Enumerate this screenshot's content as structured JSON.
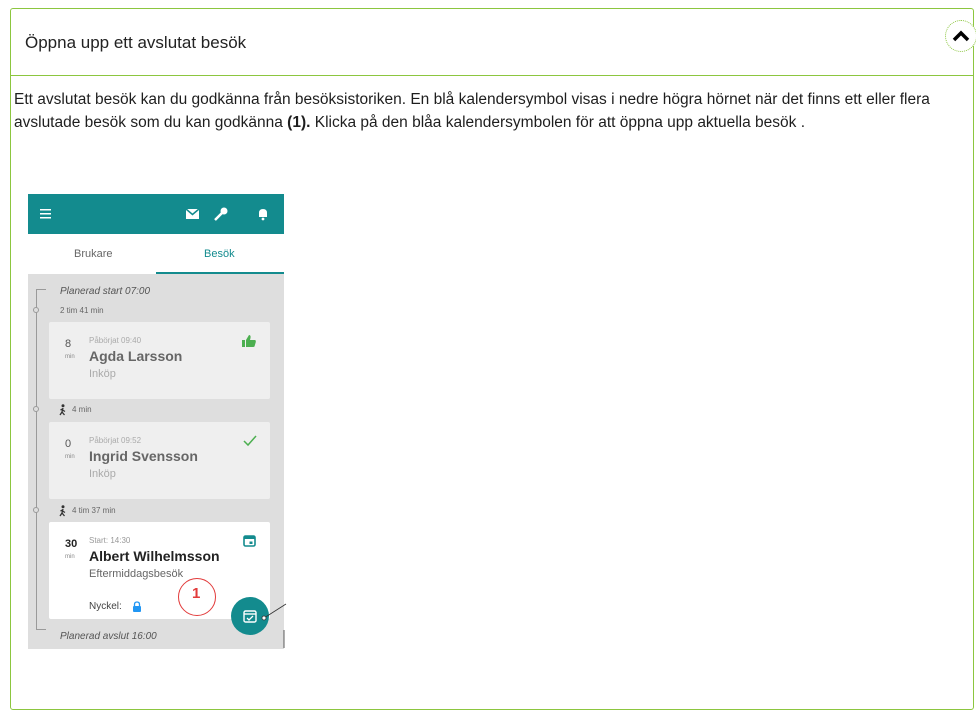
{
  "accordion": {
    "title": "Öppna upp ett avslutat besök",
    "toggle_icon": "chevron-up-icon"
  },
  "body": {
    "text_part1": "Ett avslutat besök kan du godkänna från besöksistoriken. En blå kalendersymbol visas i nedre högra hörnet när det finns ett eller flera avslutade besök som du kan godkänna ",
    "bold_ref": "(1).",
    "text_part2": " Klicka på den blåa kalendersymbolen för att öppna upp aktuella besök ."
  },
  "phone": {
    "colors": {
      "teal": "#138b8e",
      "green": "#4caf50",
      "marker": "#e23b3b"
    },
    "topbar_icons": [
      "menu-icon",
      "mail-icon",
      "key-icon",
      "bell-icon"
    ],
    "tabs": [
      {
        "label": "Brukare",
        "active": false
      },
      {
        "label": "Besök",
        "active": true
      }
    ],
    "planned_start": "Planerad start 07:00",
    "gap1": "2 tim 41 min",
    "visits": [
      {
        "minutes": "8",
        "unit": "min",
        "started": "Påbörjat 09:40",
        "name": "Agda Larsson",
        "task": "Inköp",
        "status_icon": "thumbs-up-icon"
      },
      {
        "minutes": "0",
        "unit": "min",
        "started": "Påbörjat 09:52",
        "name": "Ingrid Svensson",
        "task": "Inköp",
        "status_icon": "checkmark-icon"
      },
      {
        "minutes": "30",
        "unit": "min",
        "started": "Start: 14:30",
        "name": "Albert Wilhelmsson",
        "task": "Eftermiddagsbesök",
        "status_icon": "calendar-icon",
        "key_label": "Nyckel:"
      }
    ],
    "walk1": "4 min",
    "walk2": "4 tim 37 min",
    "planned_end": "Planerad avslut 16:00",
    "marker_number": "1"
  }
}
